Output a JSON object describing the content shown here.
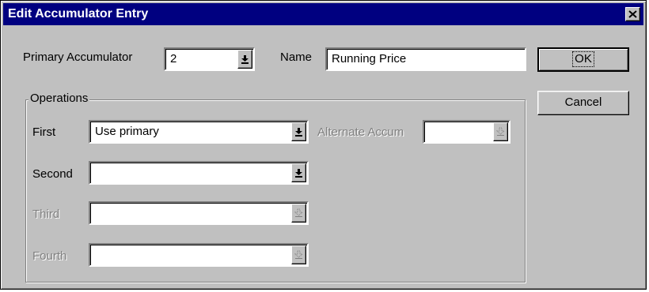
{
  "window": {
    "title": "Edit Accumulator Entry",
    "close_label": "close"
  },
  "primary": {
    "label": "Primary Accumulator",
    "value": "2"
  },
  "name": {
    "label": "Name",
    "value": "Running Price"
  },
  "buttons": {
    "ok": "OK",
    "cancel": "Cancel"
  },
  "operations": {
    "group_label": "Operations",
    "first": {
      "label": "First",
      "value": "Use primary"
    },
    "second": {
      "label": "Second",
      "value": ""
    },
    "third": {
      "label": "Third",
      "value": ""
    },
    "fourth": {
      "label": "Fourth",
      "value": ""
    },
    "alternate": {
      "label": "Alternate Accum",
      "value": ""
    }
  },
  "icons": {
    "dropdown": "dropdown-arrow-icon",
    "dropdown_disabled": "dropdown-arrow-disabled-icon",
    "close": "close-icon"
  }
}
